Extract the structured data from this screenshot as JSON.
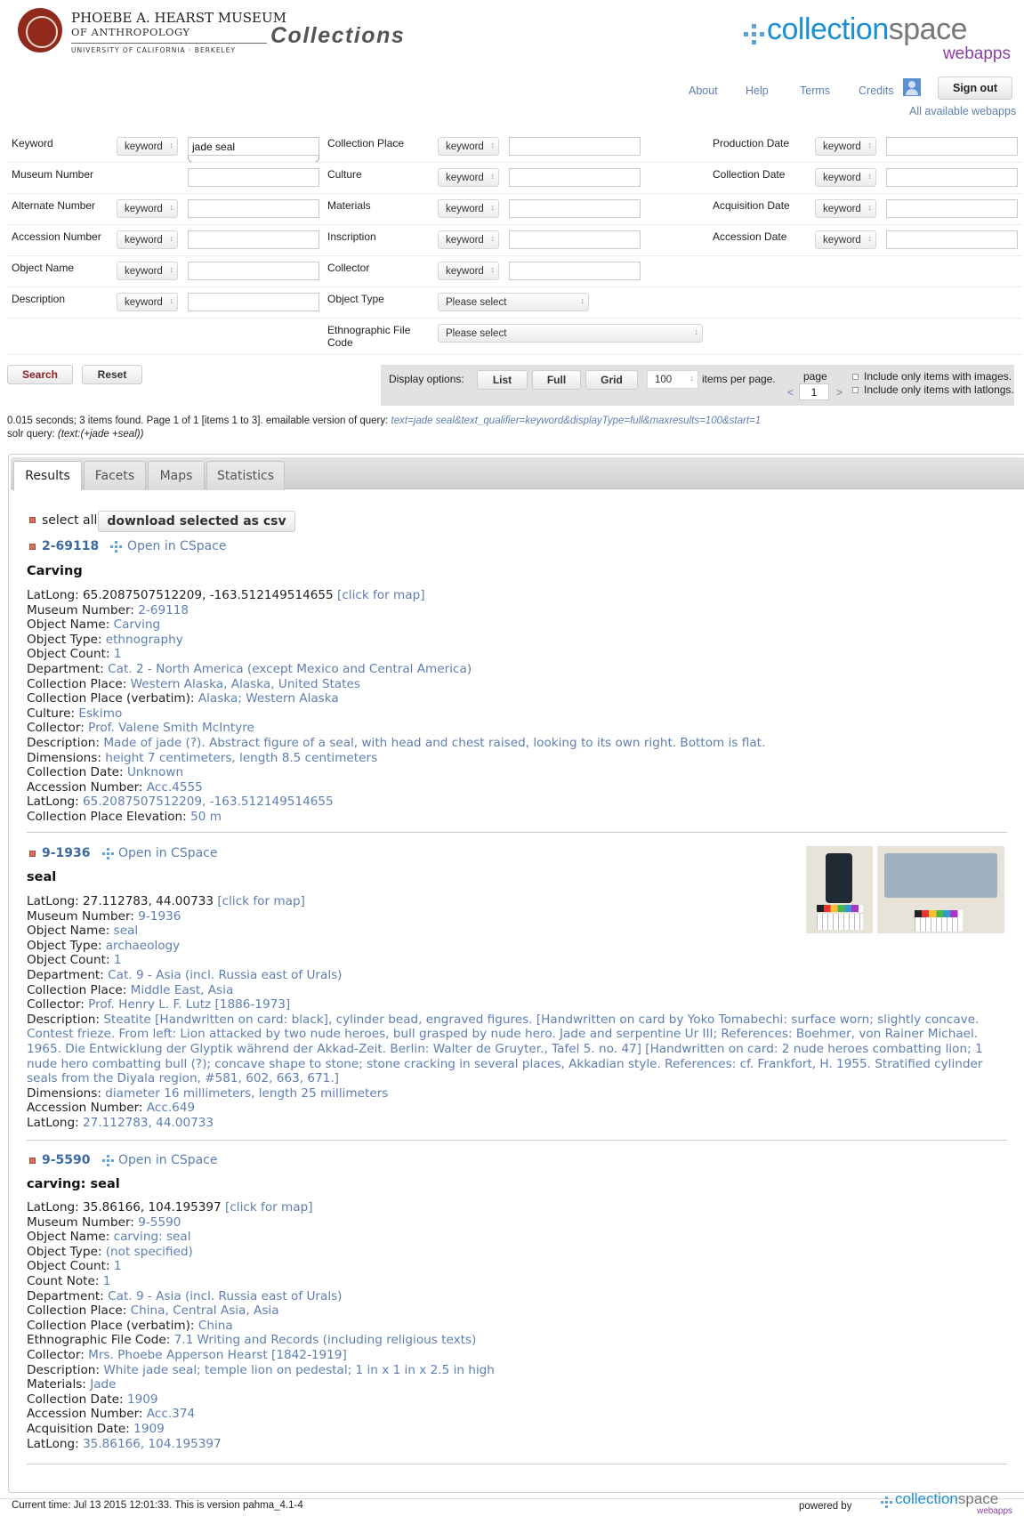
{
  "header": {
    "museum_line1": "PHOEBE A. HEARST MUSEUM",
    "museum_line2": "OF ANTHROPOLOGY",
    "museum_line3": "UNIVERSITY OF CALIFORNIA · BERKELEY",
    "app_title": "Collections",
    "cs_logo_main": "collection",
    "cs_logo_main2": "space",
    "cs_logo_sub": "webapps"
  },
  "nav": {
    "about": "About",
    "help": "Help",
    "terms": "Terms",
    "credits": "Credits",
    "sign_out": "Sign out",
    "all_webapps": "All available webapps"
  },
  "form": {
    "keyword_label": "Keyword",
    "keyword_qual": "keyword",
    "keyword_value": "jade seal",
    "museum_number_label": "Museum Number",
    "alternate_number_label": "Alternate Number",
    "alternate_number_qual": "keyword",
    "accession_number_label": "Accession Number",
    "accession_number_qual": "keyword",
    "object_name_label": "Object Name",
    "object_name_qual": "keyword",
    "description_label": "Description",
    "description_qual": "keyword",
    "collection_place_label": "Collection Place",
    "collection_place_qual": "keyword",
    "culture_label": "Culture",
    "culture_qual": "keyword",
    "materials_label": "Materials",
    "materials_qual": "keyword",
    "inscription_label": "Inscription",
    "inscription_qual": "keyword",
    "collector_label": "Collector",
    "collector_qual": "keyword",
    "object_type_label": "Object Type",
    "object_type_value": "Please select",
    "ethno_label_1": "Ethnographic File",
    "ethno_label_2": "Code",
    "ethno_value": "Please select",
    "production_date_label": "Production Date",
    "production_date_qual": "keyword",
    "collection_date_label": "Collection Date",
    "collection_date_qual": "keyword",
    "acquisition_date_label": "Acquisition Date",
    "acquisition_date_qual": "keyword",
    "accession_date_label": "Accession Date",
    "accession_date_qual": "keyword",
    "search_button": "Search",
    "reset_button": "Reset"
  },
  "display": {
    "label": "Display options:",
    "list": "List",
    "full": "Full",
    "grid": "Grid",
    "per_page": "100",
    "per_page_label": "items per page.",
    "page_label": "page",
    "page_value": "1",
    "prev": "<",
    "next": ">",
    "images_only": "Include only items with images.",
    "latlongs_only": "Include only items with latlongs."
  },
  "query": {
    "summary": "0.015 seconds; 3 items found. Page 1 of 1 [items 1 to 3]. emailable version of query:",
    "email_link": "text=jade seal&text_qualifier=keyword&displayType=full&maxresults=100&start=1",
    "solr_label": "solr query:",
    "solr_value": "(text:(+jade +seal))"
  },
  "tabs": [
    "Results",
    "Facets",
    "Maps",
    "Statistics"
  ],
  "results_head": {
    "select_all": "select all",
    "download": "download selected as csv"
  },
  "open_cs": "Open in CSpace",
  "click_map": "[click for map]",
  "results": [
    {
      "number": "2-69118",
      "title": "Carving",
      "latlong": "LatLong: 65.2087507512209, -163.512149514655",
      "fields": [
        [
          "Museum Number: ",
          "2-69118"
        ],
        [
          "Object Name: ",
          "Carving"
        ],
        [
          "Object Type: ",
          "ethnography"
        ],
        [
          "Object Count: ",
          "1"
        ],
        [
          "Department: ",
          "Cat. 2 - North America (except Mexico and Central America)"
        ],
        [
          "Collection Place: ",
          "Western Alaska, Alaska, United States"
        ],
        [
          "Collection Place (verbatim): ",
          "Alaska; Western Alaska"
        ],
        [
          "Culture: ",
          "Eskimo"
        ],
        [
          "Collector: ",
          "Prof. Valene Smith McIntyre"
        ],
        [
          "Description: ",
          "Made of jade (?). Abstract figure of a seal, with head and chest raised, looking to its own right. Bottom is flat."
        ],
        [
          "Dimensions: ",
          "height 7 centimeters, length 8.5 centimeters"
        ],
        [
          "Collection Date: ",
          "Unknown"
        ],
        [
          "Accession Number: ",
          "Acc.4555"
        ],
        [
          "LatLong: ",
          "65.2087507512209, -163.512149514655"
        ],
        [
          "Collection Place Elevation: ",
          "50 m"
        ]
      ]
    },
    {
      "number": "9-1936",
      "title": "seal",
      "latlong": "LatLong: 27.112783, 44.00733",
      "fields": [
        [
          "Museum Number: ",
          "9-1936"
        ],
        [
          "Object Name: ",
          "seal"
        ],
        [
          "Object Type: ",
          "archaeology"
        ],
        [
          "Object Count: ",
          "1"
        ],
        [
          "Department: ",
          "Cat. 9 - Asia (incl. Russia east of Urals)"
        ],
        [
          "Collection Place: ",
          "Middle East, Asia"
        ],
        [
          "Collector: ",
          "Prof. Henry L. F. Lutz [1886-1973]"
        ],
        [
          "Description: ",
          "Steatite [Handwritten on card: black], cylinder bead, engraved figures. [Handwritten on card by Yoko Tomabechi: surface worn; slightly concave. Contest frieze. From left: Lion attacked by two nude heroes, bull grasped by nude hero. Jade and serpentine Ur III; References: Boehmer, von Rainer Michael. 1965. Die Entwicklung der Glyptik während der Akkad-Zeit. Berlin: Walter de Gruyter., Tafel 5. no. 47] [Handwritten on card: 2 nude heroes combatting lion; 1 nude hero combatting bull (?); concave shape to stone; stone cracking in several places, Akkadian style. References: cf. Frankfort, H. 1955. Stratified cylinder seals from the Diyala region, #581, 602, 663, 671.]"
        ],
        [
          "Dimensions: ",
          "diameter 16 millimeters, length 25 millimeters"
        ],
        [
          "Accession Number: ",
          "Acc.649"
        ],
        [
          "LatLong: ",
          "27.112783, 44.00733"
        ]
      ]
    },
    {
      "number": "9-5590",
      "title": "carving: seal",
      "latlong": "LatLong: 35.86166, 104.195397",
      "fields": [
        [
          "Museum Number: ",
          "9-5590"
        ],
        [
          "Object Name: ",
          "carving: seal"
        ],
        [
          "Object Type: ",
          "(not specified)"
        ],
        [
          "Object Count: ",
          "1"
        ],
        [
          "Count Note: ",
          "1"
        ],
        [
          "Department: ",
          "Cat. 9 - Asia (incl. Russia east of Urals)"
        ],
        [
          "Collection Place: ",
          "China, Central Asia, Asia"
        ],
        [
          "Collection Place (verbatim): ",
          "China"
        ],
        [
          "Ethnographic File Code: ",
          "7.1 Writing and Records (including religious texts)"
        ],
        [
          "Collector: ",
          "Mrs. Phoebe Apperson Hearst [1842-1919]"
        ],
        [
          "Description: ",
          "White jade seal; temple lion on pedestal; 1 in x 1 in x 2.5 in high"
        ],
        [
          "Materials: ",
          "Jade"
        ],
        [
          "Collection Date: ",
          "1909"
        ],
        [
          "Accession Number: ",
          "Acc.374"
        ],
        [
          "Acquisition Date: ",
          "1909"
        ],
        [
          "LatLong: ",
          "35.86166, 104.195397"
        ]
      ]
    }
  ],
  "footer": {
    "current": "Current time: Jul 13 2015 12:01:33. This is version pahma_4.1-4",
    "powered": "powered by",
    "cs_main": "collection",
    "cs_main2": "space",
    "cs_sub": "webapps"
  }
}
